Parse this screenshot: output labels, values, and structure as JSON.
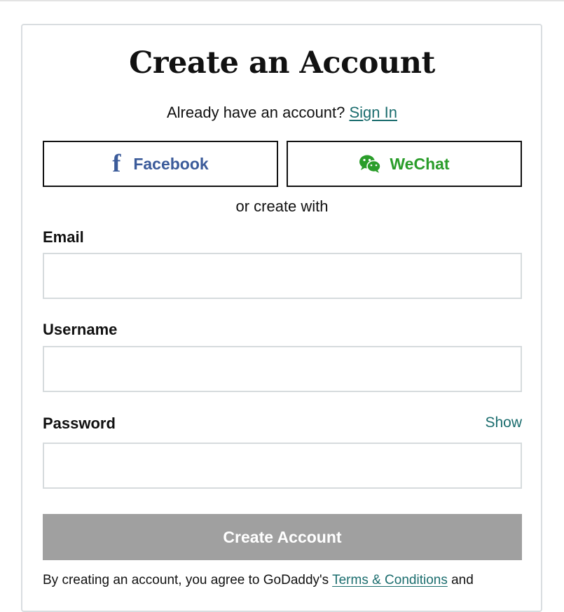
{
  "form": {
    "title": "Create an Account",
    "already_text": "Already have an account? ",
    "sign_in_label": "Sign In",
    "social": {
      "facebook_label": "Facebook",
      "wechat_label": "WeChat"
    },
    "or_text": "or create with",
    "email": {
      "label": "Email",
      "value": "",
      "placeholder": ""
    },
    "username": {
      "label": "Username",
      "value": "",
      "placeholder": ""
    },
    "password": {
      "label": "Password",
      "show_label": "Show",
      "value": "",
      "placeholder": ""
    },
    "submit_label": "Create Account",
    "legal": {
      "prefix": "By creating an account, you agree to GoDaddy's ",
      "terms_label": "Terms & Conditions",
      "suffix": " and"
    }
  },
  "icons": {
    "facebook": "facebook-icon",
    "wechat": "wechat-icon"
  },
  "colors": {
    "link": "#1b6d6e",
    "facebook": "#3b5b9a",
    "wechat": "#2a9d2a",
    "submit_disabled": "#a0a0a0",
    "border": "#d6dbdd"
  }
}
